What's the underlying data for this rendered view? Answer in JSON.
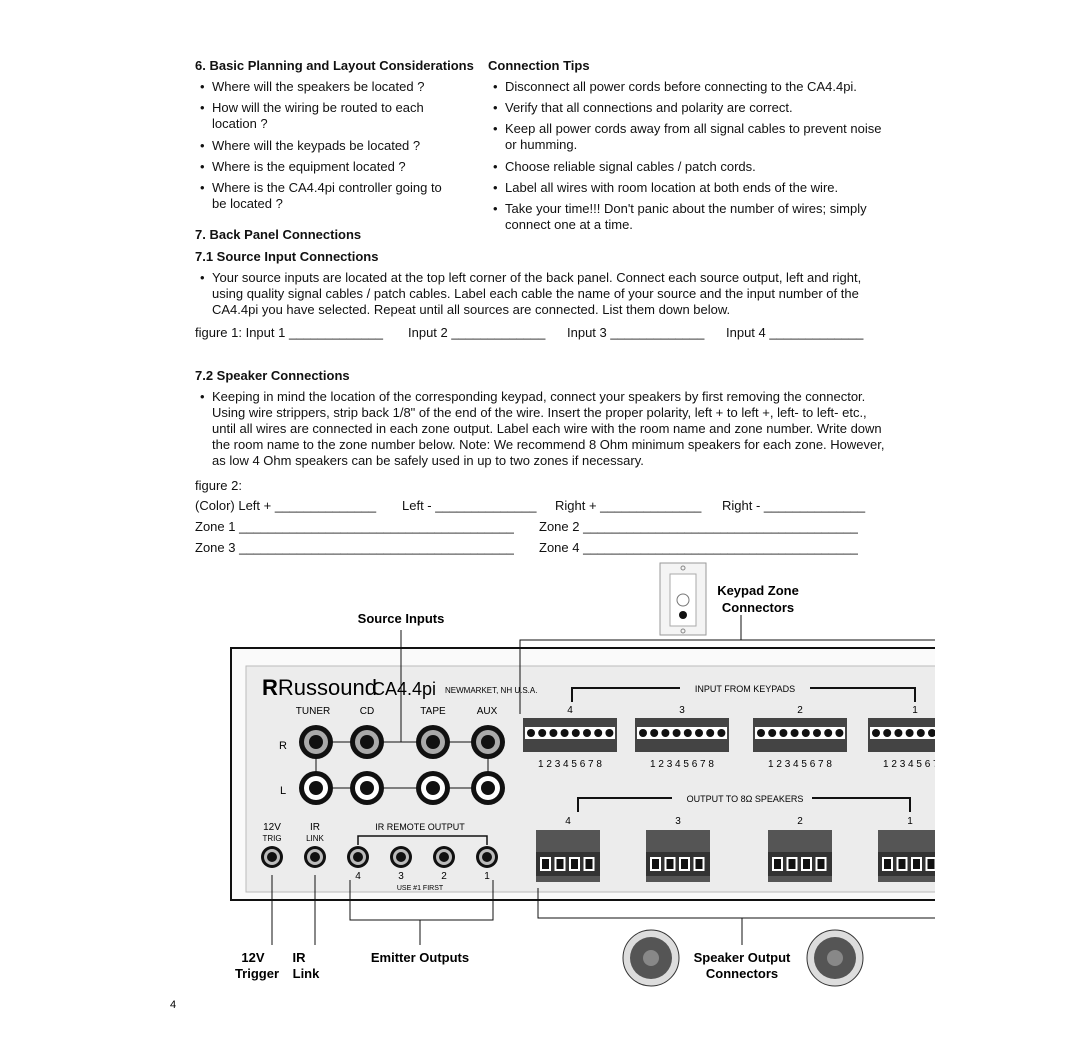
{
  "section6": {
    "title": "6. Basic Planning and Layout Considerations",
    "items": [
      "Where will the speakers be located ?",
      "How will the wiring be routed to each location ?",
      "Where will the keypads be located ?",
      "Where is the equipment located ?",
      "Where is the CA4.4pi controller going to be located ?"
    ]
  },
  "tips": {
    "title": "Connection Tips",
    "items": [
      "Disconnect all power cords before connecting to the CA4.4pi.",
      "Verify that all connections and polarity are correct.",
      "Keep all power cords away from all signal cables to prevent noise or humming.",
      "Choose reliable signal cables / patch cords.",
      "Label all wires with room location at both ends of the wire.",
      "Take your time!!! Don't panic about the number of wires; simply connect one at a time."
    ]
  },
  "section7": {
    "title": "7. Back Panel Connections",
    "sub1": "7.1 Source Input Connections",
    "para1": "Your source inputs are located at the top left corner of the back panel. Connect each source output, left and right, using quality signal cables / patch cables. Label each cable the name of your source and the input number of the CA4.4pi you have selected. Repeat until all sources are connected. List them down below.",
    "figure1": [
      "figure 1: Input 1 _____________",
      "Input 2 _____________",
      "Input 3 _____________",
      "Input 4 _____________"
    ],
    "sub2": "7.2 Speaker Connections",
    "para2": "Keeping in mind the location of the corresponding keypad, connect your speakers by first removing the connector. Using wire strippers, strip back 1/8\" of the end of the wire. Insert the proper polarity, left + to left +, left- to left- etc., until all wires are connected in each zone output. Label each wire with the room name and zone number. Write down the room name to the zone number below. Note: We recommend 8 Ohm minimum speakers for each zone. However, as low 4 Ohm speakers can be safely used in up to two zones if necessary.",
    "figure2": "figure 2:",
    "color_row": [
      "(Color)  Left + ______________",
      "Left - ______________",
      "Right + ______________",
      "Right - ______________"
    ],
    "zones": [
      "Zone 1 ______________________________________",
      "Zone 2 ______________________________________",
      "Zone 3 ______________________________________",
      "Zone 4 ______________________________________"
    ]
  },
  "diagram": {
    "source_inputs": "Source Inputs",
    "keypad_zone": "Keypad Zone",
    "connectors": "Connectors",
    "brand": "Russound",
    "model": "CA4.4pi",
    "location": "NEWMARKET, NH U.S.A.",
    "sources": [
      "TUNER",
      "CD",
      "TAPE",
      "AUX"
    ],
    "r": "R",
    "l": "L",
    "input_from_keypads": "INPUT FROM KEYPADS",
    "output_to_speakers": "OUTPUT TO 8Ω SPEAKERS",
    "zone_nums": [
      "4",
      "3",
      "2",
      "1"
    ],
    "pins": "1 2 3 4 5 6 7 8",
    "trig": [
      "12V",
      "TRIG"
    ],
    "link": [
      "IR",
      "LINK"
    ],
    "ir_remote_output": "IR REMOTE OUTPUT",
    "use_first": "USE #1 FIRST",
    "callouts": {
      "v12": "12V",
      "trigger": "Trigger",
      "ir": "IR",
      "link": "Link",
      "emitter": "Emitter Outputs",
      "speaker_output": "Speaker Output",
      "speaker_connectors": "Connectors"
    }
  },
  "page_number": "4"
}
